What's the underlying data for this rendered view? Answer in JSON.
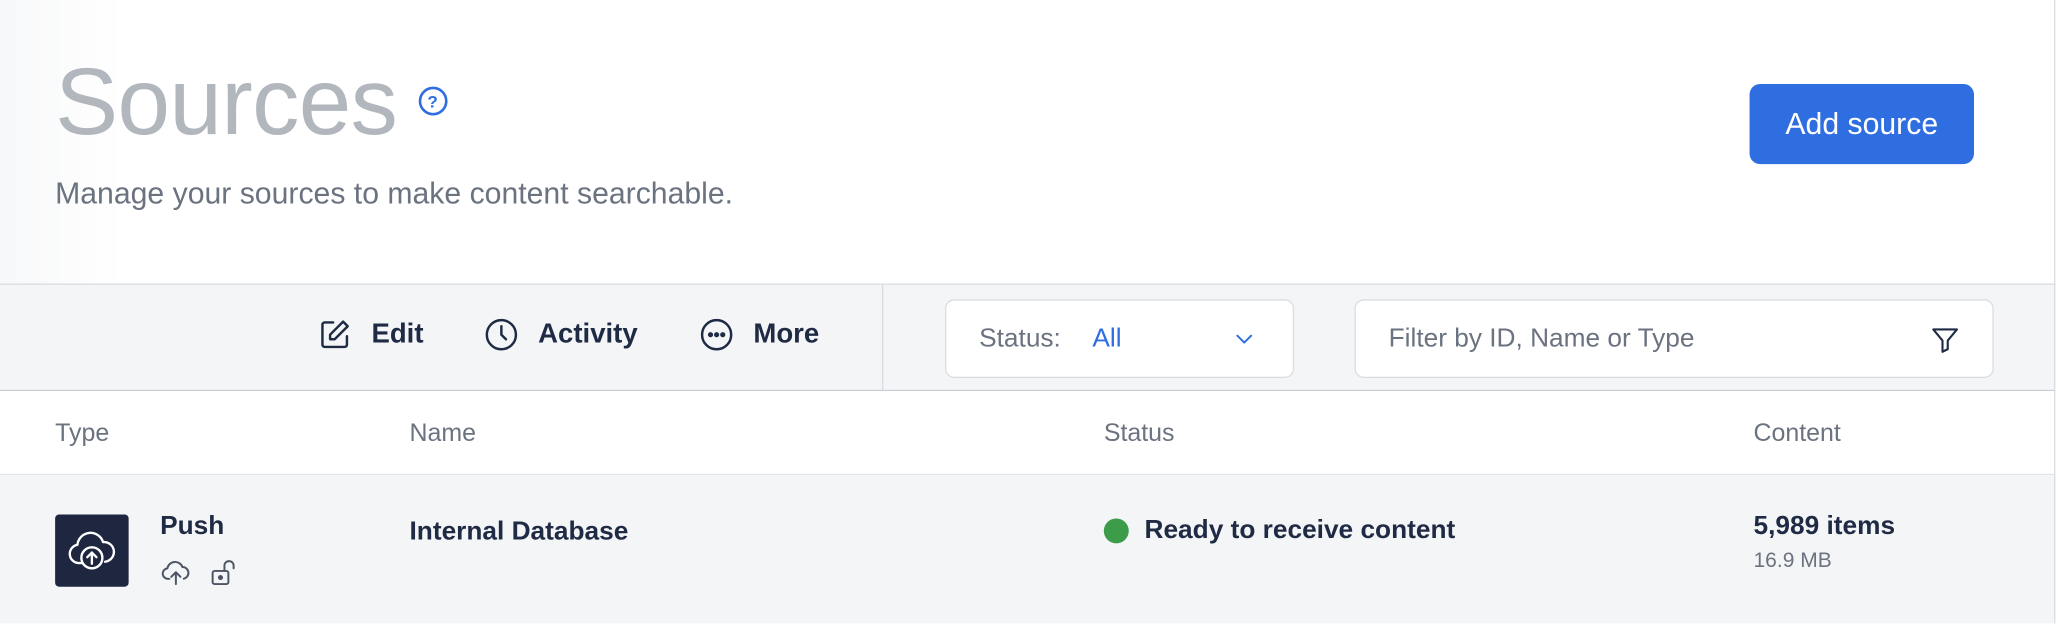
{
  "header": {
    "title": "Sources",
    "help_icon": "help-circle-icon",
    "help_glyph": "?",
    "subtitle": "Manage your sources to make content searchable.",
    "add_button_label": "Add source"
  },
  "toolbar": {
    "edit_label": "Edit",
    "activity_label": "Activity",
    "more_label": "More",
    "status_filter": {
      "label": "Status:",
      "value": "All"
    },
    "search": {
      "placeholder": "Filter by ID, Name or Type",
      "value": ""
    }
  },
  "table": {
    "columns": [
      "Type",
      "Name",
      "Status",
      "Content"
    ],
    "rows": [
      {
        "type": "Push",
        "type_icon": "cloud-upload-icon",
        "name": "Internal Database",
        "status": "Ready to receive content",
        "status_color": "#3c9c4a",
        "content_items": "5,989 items",
        "content_size": "16.9 MB"
      }
    ]
  },
  "colors": {
    "accent": "#2f6ee0",
    "dark_tile": "#1e2640",
    "status_ready": "#3c9c4a"
  }
}
